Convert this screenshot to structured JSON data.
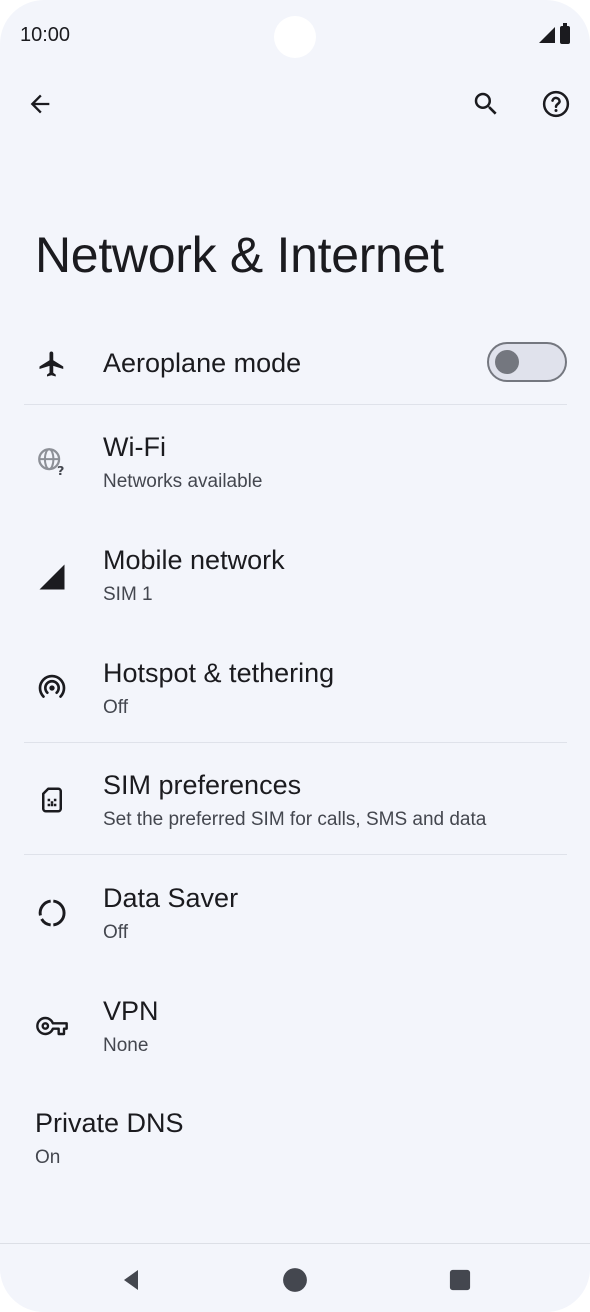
{
  "status_bar": {
    "time": "10:00"
  },
  "top_bar": {
    "back_icon": "arrow-left-icon",
    "search_icon": "search-icon",
    "help_icon": "help-circle-icon"
  },
  "page": {
    "title": "Network & Internet"
  },
  "settings": {
    "aeroplane": {
      "title": "Aeroplane mode",
      "icon": "airplane-icon",
      "toggle_on": false
    },
    "wifi": {
      "title": "Wi-Fi",
      "subtitle": "Networks available",
      "icon": "wifi-globe-question-icon"
    },
    "mobile": {
      "title": "Mobile network",
      "subtitle": "SIM 1",
      "icon": "cellular-signal-icon"
    },
    "hotspot": {
      "title": "Hotspot & tethering",
      "subtitle": "Off",
      "icon": "hotspot-icon"
    },
    "sim": {
      "title": "SIM preferences",
      "subtitle": "Set the preferred SIM for calls, SMS and data",
      "icon": "sim-card-icon"
    },
    "datasaver": {
      "title": "Data Saver",
      "subtitle": "Off",
      "icon": "data-saver-icon"
    },
    "vpn": {
      "title": "VPN",
      "subtitle": "None",
      "icon": "vpn-key-icon"
    },
    "dns": {
      "title": "Private DNS",
      "subtitle": "On"
    }
  },
  "nav_bar": {
    "back": "nav-back-icon",
    "home": "nav-home-icon",
    "recents": "nav-recents-icon"
  },
  "colors": {
    "background": "#f3f5fb",
    "text_primary": "#1b1b1f",
    "text_secondary": "#44474f",
    "divider": "#dfe2ea",
    "toggle_outline": "#74777f"
  }
}
